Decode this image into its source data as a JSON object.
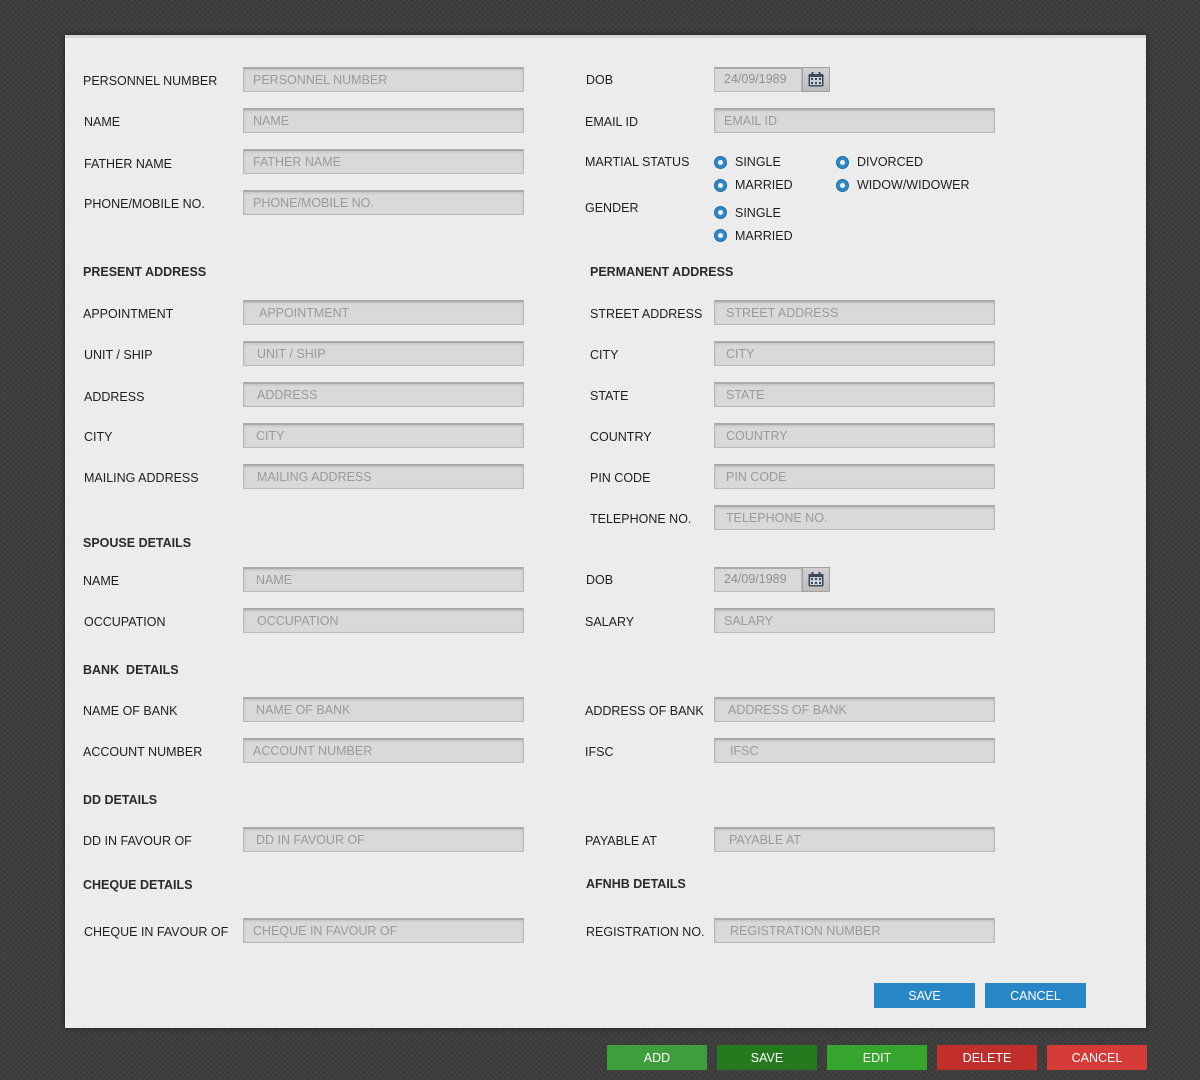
{
  "colors": {
    "panel": "#ececec",
    "field": "#d9d9d9",
    "radio": "#2f88c6",
    "primary_button": "#2787c6",
    "green": "#3f9e3c",
    "red": "#c12f2b"
  },
  "personal": {
    "personnel_number": {
      "label": "PERSONNEL NUMBER",
      "placeholder": "PERSONNEL NUMBER"
    },
    "name": {
      "label": "NAME",
      "placeholder": "NAME"
    },
    "father_name": {
      "label": "FATHER NAME",
      "placeholder": "FATHER NAME"
    },
    "phone": {
      "label": "PHONE/MOBILE NO.",
      "placeholder": "PHONE/MOBILE NO."
    },
    "dob": {
      "label": "DOB",
      "value": "24/09/1989",
      "icon": "calendar-icon"
    },
    "email": {
      "label": "EMAIL ID",
      "placeholder": "EMAIL ID"
    },
    "marital_status": {
      "label": "MARTIAL STATUS",
      "options": [
        "SINGLE",
        "DIVORCED",
        "MARRIED",
        "WIDOW/WIDOWER"
      ]
    },
    "gender": {
      "label": "GENDER",
      "options": [
        "SINGLE",
        "MARRIED"
      ]
    }
  },
  "present_address": {
    "title": "PRESENT ADDRESS",
    "appointment": {
      "label": "APPOINTMENT",
      "placeholder": "APPOINTMENT"
    },
    "unit_ship": {
      "label": "UNIT / SHIP",
      "placeholder": "UNIT / SHIP"
    },
    "address": {
      "label": "ADDRESS",
      "placeholder": "ADDRESS"
    },
    "city": {
      "label": "CITY",
      "placeholder": "CITY"
    },
    "mailing_address": {
      "label": "MAILING ADDRESS",
      "placeholder": "MAILING ADDRESS"
    }
  },
  "permanent_address": {
    "title": "PERMANENT ADDRESS",
    "street": {
      "label": "STREET ADDRESS",
      "placeholder": "STREET ADDRESS"
    },
    "city": {
      "label": "CITY",
      "placeholder": "CITY"
    },
    "state": {
      "label": "STATE",
      "placeholder": "STATE"
    },
    "country": {
      "label": "COUNTRY",
      "placeholder": "COUNTRY"
    },
    "pin": {
      "label": "PIN CODE",
      "placeholder": "PIN CODE"
    },
    "telephone": {
      "label": "TELEPHONE NO.",
      "placeholder": "TELEPHONE NO."
    }
  },
  "spouse": {
    "title": "SPOUSE DETAILS",
    "name": {
      "label": "NAME",
      "placeholder": "NAME"
    },
    "occupation": {
      "label": "OCCUPATION",
      "placeholder": "OCCUPATION"
    },
    "dob": {
      "label": "DOB",
      "value": "24/09/1989"
    },
    "salary": {
      "label": "SALARY",
      "placeholder": "SALARY"
    }
  },
  "bank": {
    "title": "BANK  DETAILS",
    "name": {
      "label": "NAME OF BANK",
      "placeholder": "NAME OF BANK"
    },
    "account": {
      "label": "ACCOUNT NUMBER",
      "placeholder": "ACCOUNT NUMBER"
    },
    "address": {
      "label": "ADDRESS OF BANK",
      "placeholder": "ADDRESS OF BANK"
    },
    "ifsc": {
      "label": "IFSC",
      "placeholder": "IFSC"
    }
  },
  "dd": {
    "title": "DD DETAILS",
    "favour": {
      "label": "DD IN FAVOUR OF",
      "placeholder": "DD IN FAVOUR OF"
    },
    "payable": {
      "label": "PAYABLE AT",
      "placeholder": "PAYABLE AT"
    }
  },
  "cheque": {
    "title": "CHEQUE DETAILS",
    "favour": {
      "label": "CHEQUE IN FAVOUR OF",
      "placeholder": "CHEQUE IN FAVOUR OF"
    }
  },
  "afnhb": {
    "title": "AFNHB DETAILS",
    "registration": {
      "label": "REGISTRATION NO.",
      "placeholder": "REGISTRATION NUMBER"
    }
  },
  "form_buttons": {
    "save": "SAVE",
    "cancel": "CANCEL"
  },
  "toolbar": {
    "add": "ADD",
    "save": "SAVE",
    "edit": "EDIT",
    "delete": "DELETE",
    "cancel": "CANCEL"
  }
}
